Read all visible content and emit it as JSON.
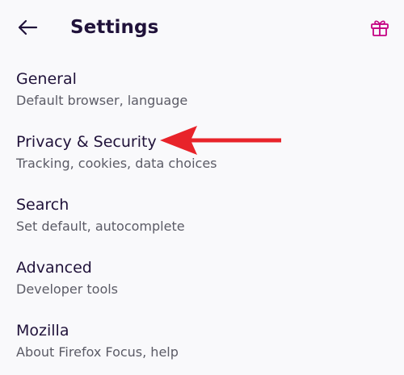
{
  "header": {
    "title": "Settings",
    "back_icon": "back-arrow-icon",
    "gift_icon": "gift-icon"
  },
  "settings": {
    "items": [
      {
        "title": "General",
        "subtitle": "Default browser, language"
      },
      {
        "title": "Privacy & Security",
        "subtitle": "Tracking, cookies, data choices"
      },
      {
        "title": "Search",
        "subtitle": "Set default, autocomplete"
      },
      {
        "title": "Advanced",
        "subtitle": "Developer tools"
      },
      {
        "title": "Mozilla",
        "subtitle": "About Firefox Focus, help"
      }
    ]
  },
  "colors": {
    "title_text": "#20123a",
    "subtitle_text": "#5b5b66",
    "gift_accent": "#c50283",
    "annotation_arrow": "#e8232a",
    "background": "#f9f9fb"
  }
}
